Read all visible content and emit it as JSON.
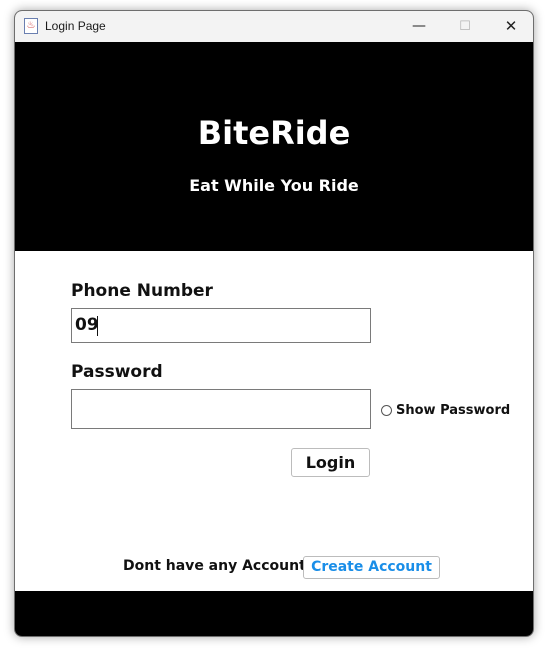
{
  "window": {
    "title": "Login Page",
    "icon": "java-cup-icon",
    "controls": {
      "minimize": "—",
      "maximize": "☐",
      "close": "✕"
    }
  },
  "header": {
    "app_name": "BiteRide",
    "tagline": "Eat While You Ride"
  },
  "form": {
    "phone": {
      "label": "Phone Number",
      "value": "09"
    },
    "password": {
      "label": "Password",
      "value": ""
    },
    "show_password": {
      "label": "Show Password",
      "checked": false
    },
    "login_button": "Login"
  },
  "footer": {
    "prompt": "Dont have any Account?",
    "create_account_button": "Create Account"
  },
  "colors": {
    "header_bg": "#000000",
    "link_blue": "#1a8ee8"
  }
}
